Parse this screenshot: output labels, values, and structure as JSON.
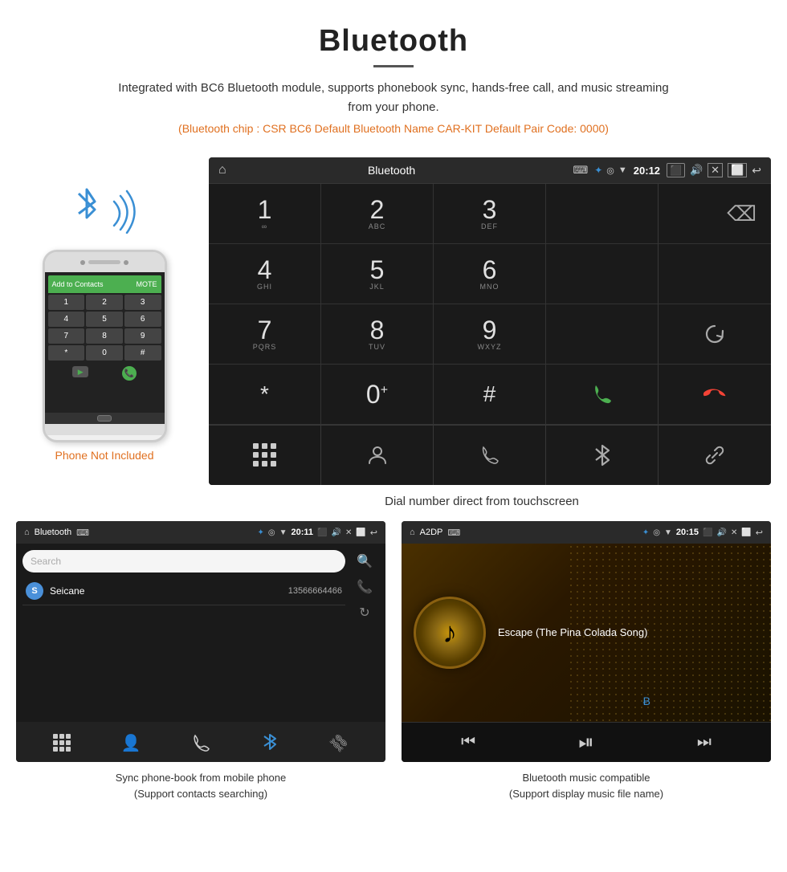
{
  "header": {
    "title": "Bluetooth",
    "description": "Integrated with BC6 Bluetooth module, supports phonebook sync, hands-free call, and music streaming from your phone.",
    "tech_specs": "(Bluetooth chip : CSR BC6    Default Bluetooth Name CAR-KIT    Default Pair Code: 0000)"
  },
  "phone_label": "Phone Not Included",
  "main_screen": {
    "status_bar": {
      "title": "Bluetooth",
      "usb_icon": "⌨",
      "time": "20:12"
    },
    "keypad": [
      {
        "number": "1",
        "letters": "∞"
      },
      {
        "number": "2",
        "letters": "ABC"
      },
      {
        "number": "3",
        "letters": "DEF"
      },
      {
        "number": "",
        "letters": ""
      },
      {
        "number": "",
        "letters": "backspace"
      },
      {
        "number": "4",
        "letters": "GHI"
      },
      {
        "number": "5",
        "letters": "JKL"
      },
      {
        "number": "6",
        "letters": "MNO"
      },
      {
        "number": "",
        "letters": ""
      },
      {
        "number": "",
        "letters": ""
      },
      {
        "number": "7",
        "letters": "PQRS"
      },
      {
        "number": "8",
        "letters": "TUV"
      },
      {
        "number": "9",
        "letters": "WXYZ"
      },
      {
        "number": "",
        "letters": ""
      },
      {
        "number": "",
        "letters": "reload"
      },
      {
        "number": "*",
        "letters": ""
      },
      {
        "number": "0",
        "letters": "+"
      },
      {
        "number": "#",
        "letters": ""
      },
      {
        "number": "",
        "letters": "call-green"
      },
      {
        "number": "",
        "letters": "call-red"
      }
    ],
    "bottom_actions": [
      "grid",
      "person",
      "phone",
      "bluetooth",
      "link"
    ]
  },
  "screen_caption": "Dial number direct from touchscreen",
  "bottom_left": {
    "status_bar": {
      "home": "⌂",
      "title": "Bluetooth",
      "usb": "⌨",
      "time": "20:11"
    },
    "search_placeholder": "Search",
    "contacts": [
      {
        "initial": "S",
        "name": "Seicane",
        "phone": "13566664466"
      }
    ],
    "caption": "Sync phone-book from mobile phone\n(Support contacts searching)"
  },
  "bottom_right": {
    "status_bar": {
      "home": "⌂",
      "title": "A2DP",
      "usb": "⌨",
      "time": "20:15"
    },
    "song_title": "Escape (The Pina Colada Song)",
    "caption": "Bluetooth music compatible\n(Support display music file name)"
  },
  "icons": {
    "home": "⌂",
    "bluetooth": "Ƀ",
    "backspace": "⌫",
    "call_green": "📞",
    "call_red": "📵",
    "person": "👤",
    "music_note": "♪",
    "search": "🔍",
    "prev": "⏮",
    "play_pause": "⏯",
    "next": "⏭"
  }
}
